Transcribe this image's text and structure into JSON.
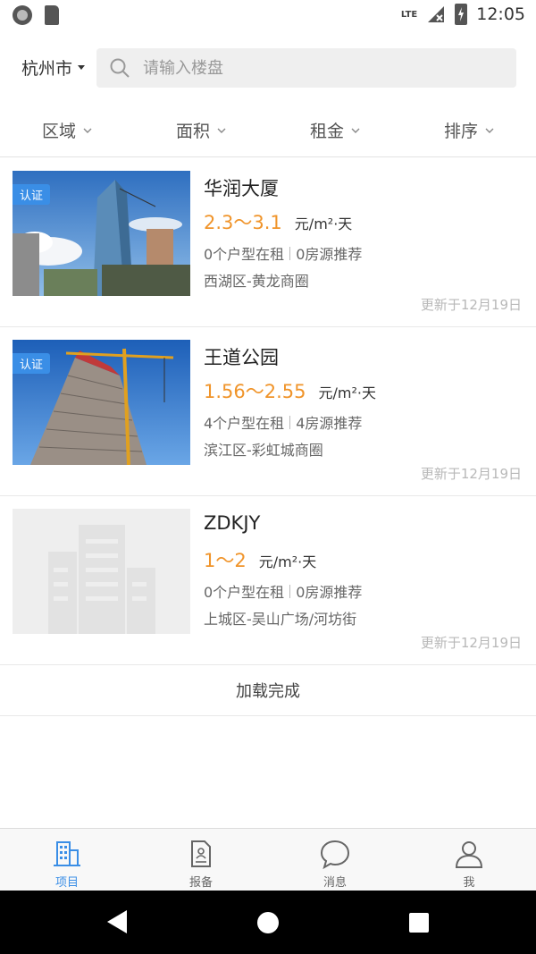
{
  "status_bar": {
    "network": "LTE",
    "time": "12:05"
  },
  "header": {
    "city": "杭州市",
    "search_placeholder": "请输入楼盘"
  },
  "filters": [
    {
      "label": "区域"
    },
    {
      "label": "面积"
    },
    {
      "label": "租金"
    },
    {
      "label": "排序"
    }
  ],
  "listings": [
    {
      "badge": "认证",
      "name": "华润大厦",
      "price": "2.3～3.1",
      "unit": "元/m²·天",
      "units_for_rent": "0个户型在租",
      "recommended": "0房源推荐",
      "district": "西湖区-黄龙商圈",
      "updated": "更新于12月19日"
    },
    {
      "badge": "认证",
      "name": "王道公园",
      "price": "1.56～2.55",
      "unit": "元/m²·天",
      "units_for_rent": "4个户型在租",
      "recommended": "4房源推荐",
      "district": "滨江区-彩虹城商圈",
      "updated": "更新于12月19日"
    },
    {
      "name": "ZDKJY",
      "price": "1～2",
      "unit": "元/m²·天",
      "units_for_rent": "0个户型在租",
      "recommended": "0房源推荐",
      "district": "上城区-吴山广场/河坊街",
      "updated": "更新于12月19日"
    }
  ],
  "load_status": "加载完成",
  "tabs": [
    {
      "label": "项目",
      "icon": "building-icon",
      "active": true
    },
    {
      "label": "报备",
      "icon": "document-icon",
      "active": false
    },
    {
      "label": "消息",
      "icon": "chat-bubble-icon",
      "active": false
    },
    {
      "label": "我",
      "icon": "person-icon",
      "active": false
    }
  ],
  "colors": {
    "accent": "#3a8ee6",
    "price": "#f0942a"
  }
}
